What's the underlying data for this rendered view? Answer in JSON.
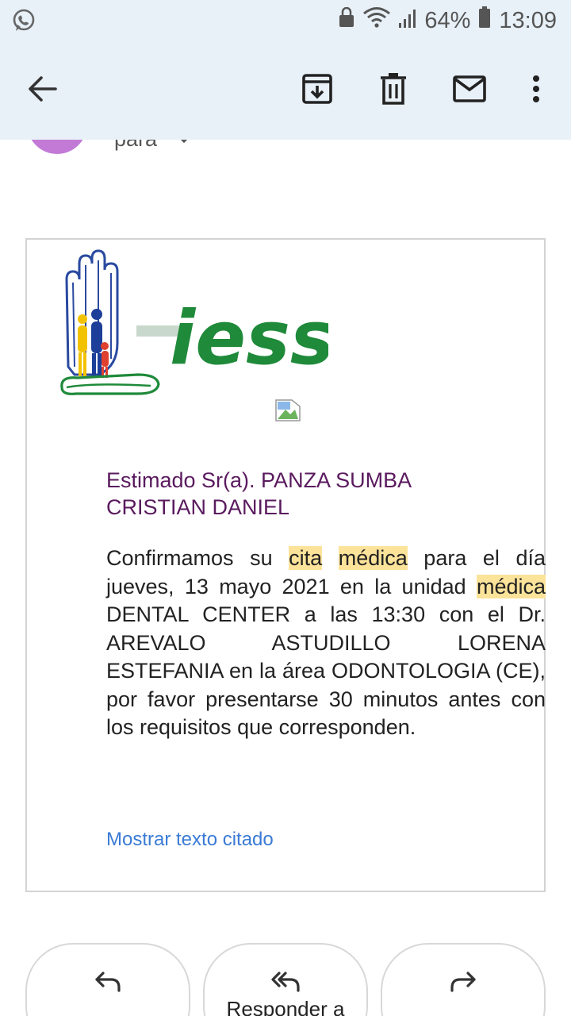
{
  "status_bar": {
    "battery": "64%",
    "time": "13:09"
  },
  "email_header": {
    "to_label": "para"
  },
  "message": {
    "logo_text": "iess",
    "greeting": "Estimado Sr(a). PANZA SUMBA CRISTIAN DANIEL",
    "body": {
      "p1": "Confirmamos su ",
      "hl1": "cita",
      "p2": " ",
      "hl2": "médica",
      "p3": " para el día jueves, 13 mayo 2021 en la unidad ",
      "hl3": "médica",
      "p4": " DENTAL CENTER a las 13:30 con el Dr. AREVALO ASTUDILLO LORENA ESTEFANIA en la área ODONTOLOGIA (CE), por favor presentarse 30 minutos antes con los requisitos que corresponden."
    },
    "show_quoted": "Mostrar texto citado"
  },
  "actions": {
    "reply_all_label": "Responder a"
  },
  "colors": {
    "appbar_bg": "#e8f0f8",
    "highlight": "#fce39a",
    "greeting": "#5a1a5e",
    "link": "#3a7bd5",
    "iess_green": "#1f8a3a"
  },
  "icons": {
    "status_left": "whatsapp-icon",
    "back": "back-arrow-icon",
    "archive": "archive-icon",
    "delete": "trash-icon",
    "mark_unread": "mail-icon",
    "more": "more-vert-icon",
    "reply": "reply-icon",
    "reply_all": "reply-all-icon",
    "forward": "forward-icon"
  }
}
